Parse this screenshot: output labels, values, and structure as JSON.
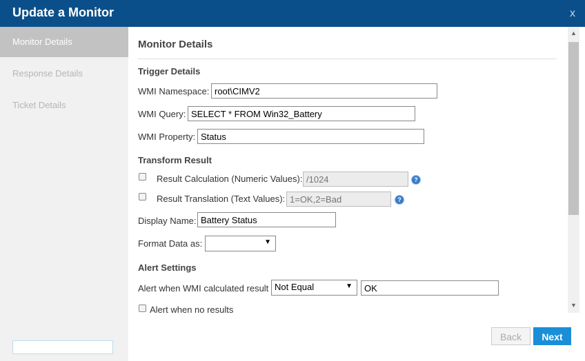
{
  "dialog": {
    "title": "Update a Monitor",
    "close_glyph": "x"
  },
  "sidebar": {
    "items": [
      {
        "label": "Monitor Details"
      },
      {
        "label": "Response Details"
      },
      {
        "label": "Ticket Details"
      }
    ]
  },
  "main": {
    "heading": "Monitor Details",
    "trigger": {
      "title": "Trigger Details",
      "namespace_label": "WMI Namespace:",
      "namespace_value": "root\\CIMV2",
      "query_label": "WMI Query:",
      "query_value": "SELECT * FROM Win32_Battery",
      "property_label": "WMI Property:",
      "property_value": "Status"
    },
    "transform": {
      "title": "Transform Result",
      "calc_label": "Result Calculation (Numeric Values):",
      "calc_placeholder": "/1024",
      "translation_label": "Result Translation (Text Values):",
      "translation_placeholder": "1=OK,2=Bad",
      "display_name_label": "Display Name:",
      "display_name_value": "Battery Status",
      "format_label": "Format Data as:",
      "format_value": ""
    },
    "alert": {
      "title": "Alert Settings",
      "condition_label": "Alert when WMI calculated result",
      "condition_value": "Not Equal",
      "result_value": "OK",
      "no_results_label": "Alert when no results"
    },
    "help_glyph": "?",
    "dropdown_glyph": "▼"
  },
  "footer": {
    "back_label": "Back",
    "next_label": "Next"
  },
  "colors": {
    "titlebar": "#0b4f8a",
    "next_button": "#1a8fd8",
    "sidebar_active": "#c2c2c2"
  }
}
